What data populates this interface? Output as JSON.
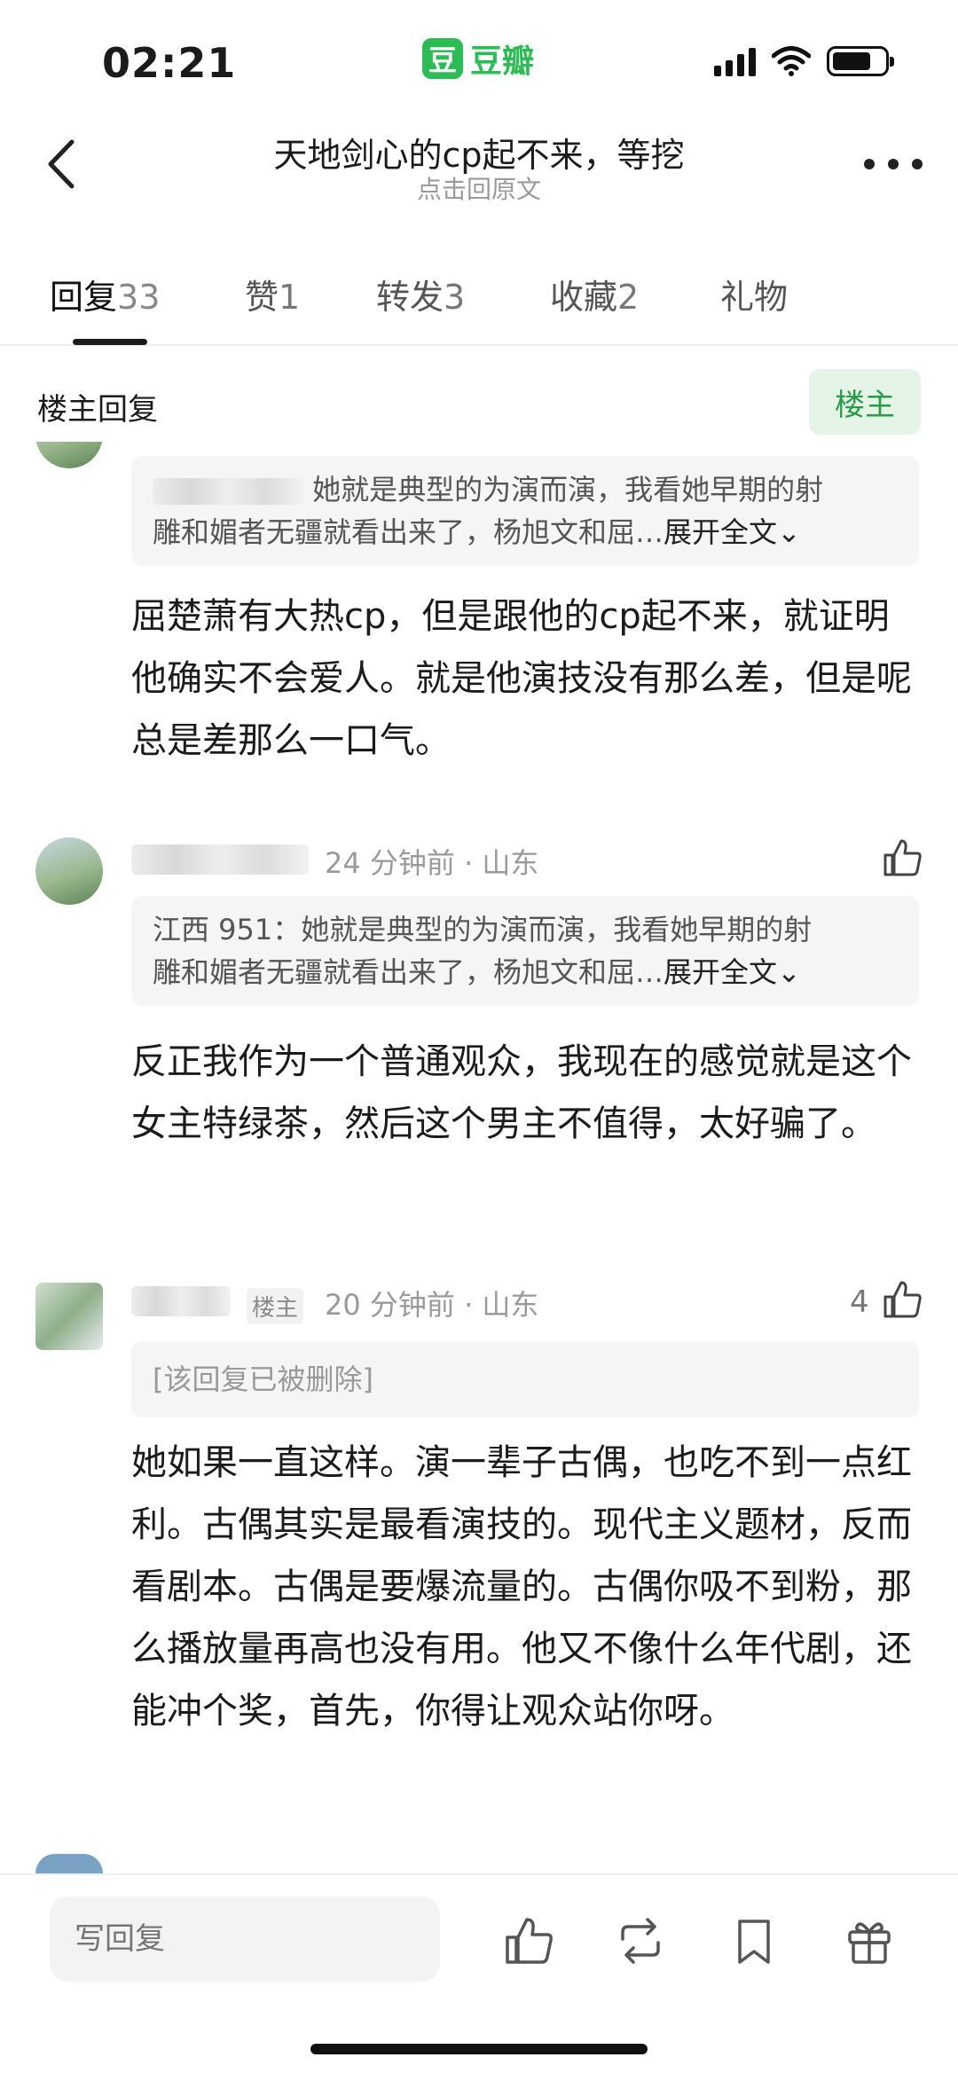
{
  "status": {
    "time": "02:21",
    "app_logo": "豆",
    "app_name": "豆瓣"
  },
  "header": {
    "title": "天地剑心的cp起不来，等挖",
    "subtitle": "点击回原文"
  },
  "tabs": [
    {
      "label": "回复",
      "count": "33"
    },
    {
      "label": "赞",
      "count": "1"
    },
    {
      "label": "转发",
      "count": "3"
    },
    {
      "label": "收藏",
      "count": "2"
    },
    {
      "label": "礼物",
      "count": ""
    }
  ],
  "section": {
    "title": "楼主回复",
    "owner_button": "楼主"
  },
  "comments": [
    {
      "quote_author": "",
      "quote_text": "她就是典型的为演而演，我看她早期的射",
      "quote_text_2": "雕和媚者无疆就看出来了，杨旭文和屈…",
      "expand_label": "展开全文",
      "body": "屈楚萧有大热cp，但是跟他的cp起不来，就证明他确实不会爱人。就是他演技没有那么差，但是呢总是差那么一口气。"
    },
    {
      "meta": "24 分钟前 · 山东",
      "quote_author": "江西 951：",
      "quote_text": "她就是典型的为演而演，我看她早期的射",
      "quote_text_2": "雕和媚者无疆就看出来了，杨旭文和屈…",
      "expand_label": "展开全文",
      "body": "反正我作为一个普通观众，我现在的感觉就是这个女主特绿茶，然后这个男主不值得，太好骗了。"
    },
    {
      "owner_tag": "楼主",
      "meta": "20 分钟前 · 山东",
      "likes": "4",
      "deleted_text": "[该回复已被删除]",
      "body": "她如果一直这样。演一辈子古偶，也吃不到一点红利。古偶其实是最看演技的。现代主义题材，反而看剧本。古偶是要爆流量的。古偶你吸不到粉，那么播放量再高也没有用。他又不像什么年代剧，还能冲个奖，首先，你得让观众站你呀。"
    }
  ],
  "bottom": {
    "reply_placeholder": "写回复"
  },
  "colors": {
    "accent": "#2dbb55",
    "owner_bg": "#e4f5e8",
    "owner_text": "#2a9b47"
  },
  "icons": [
    "back-icon",
    "more-icon",
    "like-icon",
    "repost-icon",
    "bookmark-icon",
    "gift-icon"
  ]
}
